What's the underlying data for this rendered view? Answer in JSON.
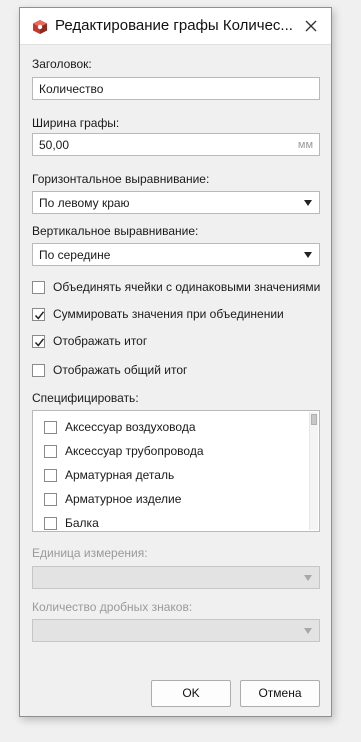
{
  "window": {
    "title": "Редактирование графы Количес...",
    "app_icon": "app-cube-icon",
    "close_icon": "close-icon"
  },
  "form": {
    "header_label": "Заголовок:",
    "header_value": "Количество",
    "width_label": "Ширина графы:",
    "width_value": "50,00",
    "width_unit": "мм",
    "halign_label": "Горизонтальное выравнивание:",
    "halign_value": "По левому краю",
    "valign_label": "Вертикальное выравнивание:",
    "valign_value": "По середине",
    "options": [
      {
        "label": "Объединять ячейки с одинаковыми значениями",
        "checked": false
      },
      {
        "label": "Суммировать значения при объединении",
        "checked": true
      },
      {
        "label": "Отображать итог",
        "checked": true
      },
      {
        "label": "Отображать общий итог",
        "checked": false
      }
    ],
    "specify_label": "Специфицировать:",
    "specify_items": [
      {
        "label": "Аксессуар воздуховода",
        "checked": false
      },
      {
        "label": "Аксессуар трубопровода",
        "checked": false
      },
      {
        "label": "Арматурная деталь",
        "checked": false
      },
      {
        "label": "Арматурное изделие",
        "checked": false
      },
      {
        "label": "Балка",
        "checked": false
      }
    ],
    "unit_label": "Единица измерения:",
    "unit_value": "",
    "decimals_label": "Количество дробных знаков:",
    "decimals_value": ""
  },
  "buttons": {
    "ok": "OK",
    "cancel": "Отмена"
  },
  "colors": {
    "dialog_bg": "#f0f0f0",
    "titlebar_bg": "#ffffff",
    "disabled_text": "#9a9a9a",
    "icon_red": "#c0392b"
  }
}
